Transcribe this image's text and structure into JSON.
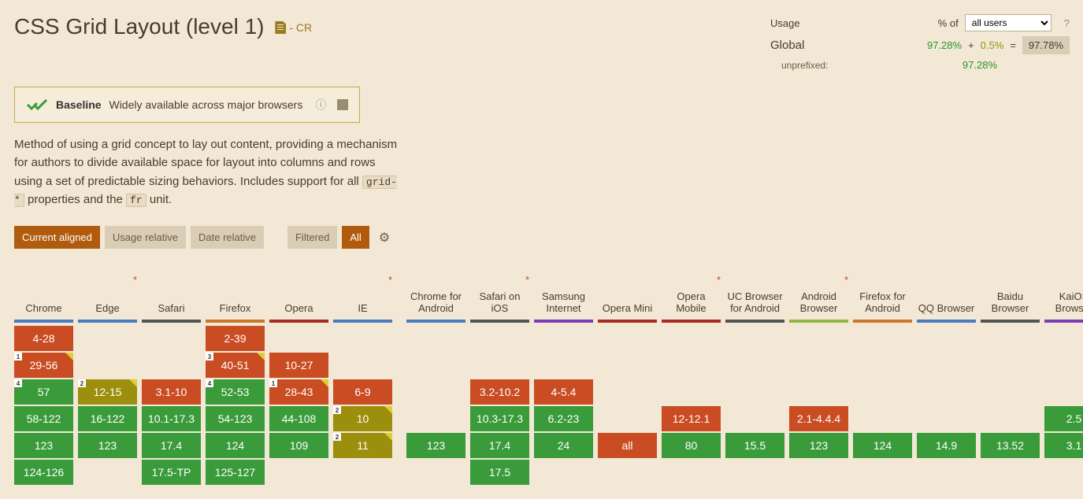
{
  "title": "CSS Grid Layout (level 1)",
  "spec_status": "- CR",
  "baseline": {
    "label": "Baseline",
    "text": "Widely available across major browsers"
  },
  "description_parts": {
    "p1": "Method of using a grid concept to lay out content, providing a mechanism for authors to divide available space for layout into columns and rows using a set of predictable sizing behaviors. Includes support for all ",
    "code1": "grid-*",
    "p2": " properties and the ",
    "code2": "fr",
    "p3": " unit."
  },
  "buttons": {
    "current_aligned": "Current aligned",
    "usage_relative": "Usage relative",
    "date_relative": "Date relative",
    "filtered": "Filtered",
    "all": "All"
  },
  "usage": {
    "label": "Usage",
    "percent_of": "% of",
    "select_value": "all users",
    "question": "?",
    "global_label": "Global",
    "main_pct": "97.28%",
    "plus": "+",
    "partial_pct": "0.5%",
    "equals": "=",
    "total_pct": "97.78%",
    "unprefixed_label": "unprefixed:",
    "unprefixed_pct": "97.28%"
  },
  "browsers": {
    "desktop": [
      {
        "name": "Chrome",
        "bar": "bar-chrome",
        "star": false,
        "rows": [
          {
            "type": "red",
            "text": "4-28"
          },
          {
            "type": "red",
            "text": "29-56",
            "note": "1",
            "flag": "yellow"
          },
          {
            "type": "green",
            "text": "57",
            "note": "4"
          },
          {
            "type": "green",
            "text": "58-122"
          },
          {
            "type": "green",
            "text": "123"
          },
          {
            "type": "green",
            "text": "124-126"
          }
        ]
      },
      {
        "name": "Edge",
        "bar": "bar-edge",
        "star": true,
        "rows": [
          {
            "type": "empty"
          },
          {
            "type": "empty"
          },
          {
            "type": "olive",
            "text": "12-15",
            "note": "2",
            "flag": "yellow"
          },
          {
            "type": "green",
            "text": "16-122"
          },
          {
            "type": "green",
            "text": "123"
          },
          {
            "type": "empty"
          }
        ]
      },
      {
        "name": "Safari",
        "bar": "bar-safari",
        "star": false,
        "rows": [
          {
            "type": "empty"
          },
          {
            "type": "empty"
          },
          {
            "type": "red",
            "text": "3.1-10"
          },
          {
            "type": "green",
            "text": "10.1-17.3"
          },
          {
            "type": "green",
            "text": "17.4"
          },
          {
            "type": "green",
            "text": "17.5-TP"
          }
        ]
      },
      {
        "name": "Firefox",
        "bar": "bar-firefox",
        "star": false,
        "rows": [
          {
            "type": "red",
            "text": "2-39"
          },
          {
            "type": "red",
            "text": "40-51",
            "note": "3",
            "flag": "yellow"
          },
          {
            "type": "green",
            "text": "52-53",
            "note": "4"
          },
          {
            "type": "green",
            "text": "54-123"
          },
          {
            "type": "green",
            "text": "124"
          },
          {
            "type": "green",
            "text": "125-127"
          }
        ]
      },
      {
        "name": "Opera",
        "bar": "bar-opera",
        "star": false,
        "rows": [
          {
            "type": "empty"
          },
          {
            "type": "red",
            "text": "10-27"
          },
          {
            "type": "red",
            "text": "28-43",
            "note": "1",
            "flag": "yellow"
          },
          {
            "type": "green",
            "text": "44-108"
          },
          {
            "type": "green",
            "text": "109"
          },
          {
            "type": "empty"
          }
        ]
      },
      {
        "name": "IE",
        "bar": "bar-ie",
        "star": true,
        "rows": [
          {
            "type": "empty"
          },
          {
            "type": "empty"
          },
          {
            "type": "red",
            "text": "6-9"
          },
          {
            "type": "olive",
            "text": "10",
            "note": "2",
            "flag": "yellow"
          },
          {
            "type": "olive",
            "text": "11",
            "note": "2",
            "flag": "yellow"
          },
          {
            "type": "empty"
          }
        ]
      }
    ],
    "mobile": [
      {
        "name": "Chrome for Android",
        "bar": "bar-chrome-android",
        "star": false,
        "rows": [
          {
            "type": "empty"
          },
          {
            "type": "empty"
          },
          {
            "type": "empty"
          },
          {
            "type": "empty"
          },
          {
            "type": "green",
            "text": "123"
          },
          {
            "type": "empty"
          }
        ]
      },
      {
        "name": "Safari on iOS",
        "bar": "bar-safari-ios",
        "star": true,
        "rows": [
          {
            "type": "empty"
          },
          {
            "type": "empty"
          },
          {
            "type": "red",
            "text": "3.2-10.2"
          },
          {
            "type": "green",
            "text": "10.3-17.3"
          },
          {
            "type": "green",
            "text": "17.4"
          },
          {
            "type": "green",
            "text": "17.5"
          }
        ]
      },
      {
        "name": "Samsung Internet",
        "bar": "bar-samsung",
        "star": false,
        "rows": [
          {
            "type": "empty"
          },
          {
            "type": "empty"
          },
          {
            "type": "red",
            "text": "4-5.4"
          },
          {
            "type": "green",
            "text": "6.2-23"
          },
          {
            "type": "green",
            "text": "24"
          },
          {
            "type": "empty"
          }
        ]
      },
      {
        "name": "Opera Mini",
        "bar": "bar-opera-mini",
        "star": false,
        "rows": [
          {
            "type": "empty"
          },
          {
            "type": "empty"
          },
          {
            "type": "empty"
          },
          {
            "type": "empty"
          },
          {
            "type": "red",
            "text": "all"
          },
          {
            "type": "empty"
          }
        ]
      },
      {
        "name": "Opera Mobile",
        "bar": "bar-opera-mobile",
        "star": true,
        "rows": [
          {
            "type": "empty"
          },
          {
            "type": "empty"
          },
          {
            "type": "empty"
          },
          {
            "type": "red",
            "text": "12-12.1"
          },
          {
            "type": "green",
            "text": "80"
          },
          {
            "type": "empty"
          }
        ]
      },
      {
        "name": "UC Browser for Android",
        "bar": "bar-uc",
        "star": false,
        "rows": [
          {
            "type": "empty"
          },
          {
            "type": "empty"
          },
          {
            "type": "empty"
          },
          {
            "type": "empty"
          },
          {
            "type": "green",
            "text": "15.5"
          },
          {
            "type": "empty"
          }
        ]
      },
      {
        "name": "Android Browser",
        "bar": "bar-android",
        "star": true,
        "rows": [
          {
            "type": "empty"
          },
          {
            "type": "empty"
          },
          {
            "type": "empty"
          },
          {
            "type": "red",
            "text": "2.1-4.4.4"
          },
          {
            "type": "green",
            "text": "123"
          },
          {
            "type": "empty"
          }
        ]
      },
      {
        "name": "Firefox for Android",
        "bar": "bar-firefox-android",
        "star": false,
        "rows": [
          {
            "type": "empty"
          },
          {
            "type": "empty"
          },
          {
            "type": "empty"
          },
          {
            "type": "empty"
          },
          {
            "type": "green",
            "text": "124"
          },
          {
            "type": "empty"
          }
        ]
      },
      {
        "name": "QQ Browser",
        "bar": "bar-qq",
        "star": false,
        "rows": [
          {
            "type": "empty"
          },
          {
            "type": "empty"
          },
          {
            "type": "empty"
          },
          {
            "type": "empty"
          },
          {
            "type": "green",
            "text": "14.9"
          },
          {
            "type": "empty"
          }
        ]
      },
      {
        "name": "Baidu Browser",
        "bar": "bar-baidu",
        "star": false,
        "rows": [
          {
            "type": "empty"
          },
          {
            "type": "empty"
          },
          {
            "type": "empty"
          },
          {
            "type": "empty"
          },
          {
            "type": "green",
            "text": "13.52"
          },
          {
            "type": "empty"
          }
        ]
      },
      {
        "name": "KaiOS Browser",
        "bar": "bar-kaios",
        "star": false,
        "rows": [
          {
            "type": "empty"
          },
          {
            "type": "empty"
          },
          {
            "type": "empty"
          },
          {
            "type": "green",
            "text": "2.5"
          },
          {
            "type": "green",
            "text": "3.1"
          },
          {
            "type": "empty"
          }
        ]
      }
    ]
  }
}
